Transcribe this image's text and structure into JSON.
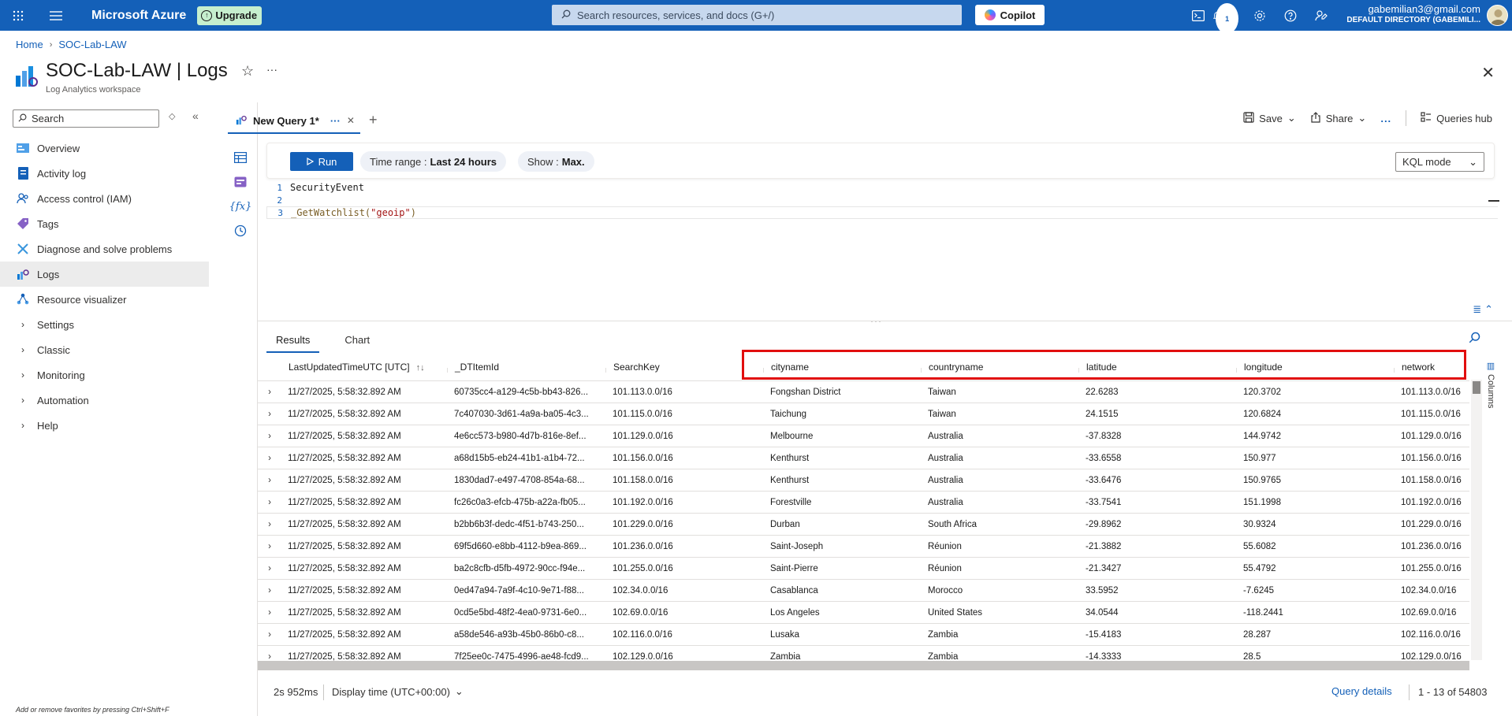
{
  "topbar": {
    "brand": "Microsoft Azure",
    "upgrade_label": "Upgrade",
    "search_placeholder": "Search resources, services, and docs (G+/)",
    "copilot_label": "Copilot",
    "notification_count": "1",
    "user_email": "gabemilian3@gmail.com",
    "user_directory": "DEFAULT DIRECTORY (GABEMILI..."
  },
  "breadcrumb": [
    "Home",
    "SOC-Lab-LAW"
  ],
  "header": {
    "title": "SOC-Lab-LAW | Logs",
    "subtitle": "Log Analytics workspace"
  },
  "sidebar": {
    "search_placeholder": "Search",
    "items": [
      {
        "label": "Overview",
        "icon": "overview-icon"
      },
      {
        "label": "Activity log",
        "icon": "activity-log-icon"
      },
      {
        "label": "Access control (IAM)",
        "icon": "iam-icon"
      },
      {
        "label": "Tags",
        "icon": "tag-icon"
      },
      {
        "label": "Diagnose and solve problems",
        "icon": "wrench-icon"
      },
      {
        "label": "Logs",
        "icon": "logs-icon",
        "active": true
      },
      {
        "label": "Resource visualizer",
        "icon": "visualizer-icon"
      },
      {
        "label": "Settings",
        "expandable": true
      },
      {
        "label": "Classic",
        "expandable": true
      },
      {
        "label": "Monitoring",
        "expandable": true
      },
      {
        "label": "Automation",
        "expandable": true
      },
      {
        "label": "Help",
        "expandable": true
      }
    ],
    "footer_hint": "Add or remove favorites by pressing Ctrl+Shift+F"
  },
  "query_tab": {
    "label": "New Query 1*"
  },
  "toolbar": {
    "save_label": "Save",
    "share_label": "Share",
    "more_label": "...",
    "queries_hub_label": "Queries hub"
  },
  "runbar": {
    "run_label": "Run",
    "time_range_label": "Time range :",
    "time_range_value": "Last 24 hours",
    "show_label": "Show :",
    "show_value": "Max.",
    "mode": "KQL mode"
  },
  "editor": {
    "lines": [
      {
        "num": "1",
        "text": "SecurityEvent"
      },
      {
        "num": "2",
        "text": ""
      },
      {
        "num": "3",
        "fn": "_GetWatchlist(",
        "str": "\"geoip\"",
        "close": ")"
      }
    ]
  },
  "results": {
    "tabs": [
      "Results",
      "Chart"
    ],
    "columns": [
      "LastUpdatedTimeUTC [UTC]",
      "_DTItemId",
      "SearchKey",
      "cityname",
      "countryname",
      "latitude",
      "longitude",
      "network"
    ],
    "rows": [
      [
        "11/27/2025, 5:58:32.892 AM",
        "60735cc4-a129-4c5b-bb43-826...",
        "101.113.0.0/16",
        "Fongshan District",
        "Taiwan",
        "22.6283",
        "120.3702",
        "101.113.0.0/16"
      ],
      [
        "11/27/2025, 5:58:32.892 AM",
        "7c407030-3d61-4a9a-ba05-4c3...",
        "101.115.0.0/16",
        "Taichung",
        "Taiwan",
        "24.1515",
        "120.6824",
        "101.115.0.0/16"
      ],
      [
        "11/27/2025, 5:58:32.892 AM",
        "4e6cc573-b980-4d7b-816e-8ef...",
        "101.129.0.0/16",
        "Melbourne",
        "Australia",
        "-37.8328",
        "144.9742",
        "101.129.0.0/16"
      ],
      [
        "11/27/2025, 5:58:32.892 AM",
        "a68d15b5-eb24-41b1-a1b4-72...",
        "101.156.0.0/16",
        "Kenthurst",
        "Australia",
        "-33.6558",
        "150.977",
        "101.156.0.0/16"
      ],
      [
        "11/27/2025, 5:58:32.892 AM",
        "1830dad7-e497-4708-854a-68...",
        "101.158.0.0/16",
        "Kenthurst",
        "Australia",
        "-33.6476",
        "150.9765",
        "101.158.0.0/16"
      ],
      [
        "11/27/2025, 5:58:32.892 AM",
        "fc26c0a3-efcb-475b-a22a-fb05...",
        "101.192.0.0/16",
        "Forestville",
        "Australia",
        "-33.7541",
        "151.1998",
        "101.192.0.0/16"
      ],
      [
        "11/27/2025, 5:58:32.892 AM",
        "b2bb6b3f-dedc-4f51-b743-250...",
        "101.229.0.0/16",
        "Durban",
        "South Africa",
        "-29.8962",
        "30.9324",
        "101.229.0.0/16"
      ],
      [
        "11/27/2025, 5:58:32.892 AM",
        "69f5d660-e8bb-4112-b9ea-869...",
        "101.236.0.0/16",
        "Saint-Joseph",
        "Réunion",
        "-21.3882",
        "55.6082",
        "101.236.0.0/16"
      ],
      [
        "11/27/2025, 5:58:32.892 AM",
        "ba2c8cfb-d5fb-4972-90cc-f94e...",
        "101.255.0.0/16",
        "Saint-Pierre",
        "Réunion",
        "-21.3427",
        "55.4792",
        "101.255.0.0/16"
      ],
      [
        "11/27/2025, 5:58:32.892 AM",
        "0ed47a94-7a9f-4c10-9e71-f88...",
        "102.34.0.0/16",
        "Casablanca",
        "Morocco",
        "33.5952",
        "-7.6245",
        "102.34.0.0/16"
      ],
      [
        "11/27/2025, 5:58:32.892 AM",
        "0cd5e5bd-48f2-4ea0-9731-6e0...",
        "102.69.0.0/16",
        "Los Angeles",
        "United States",
        "34.0544",
        "-118.2441",
        "102.69.0.0/16"
      ],
      [
        "11/27/2025, 5:58:32.892 AM",
        "a58de546-a93b-45b0-86b0-c8...",
        "102.116.0.0/16",
        "Lusaka",
        "Zambia",
        "-15.4183",
        "28.287",
        "102.116.0.0/16"
      ],
      [
        "11/27/2025, 5:58:32.892 AM",
        "7f25ee0c-7475-4996-ae48-fcd9...",
        "102.129.0.0/16",
        "Zambia",
        "Zambia",
        "-14.3333",
        "28.5",
        "102.129.0.0/16"
      ]
    ],
    "columns_panel_label": "Columns"
  },
  "status": {
    "duration": "2s 952ms",
    "display_time": "Display time (UTC+00:00)",
    "query_details": "Query details",
    "count": "1 - 13 of 54803"
  },
  "colors": {
    "topbar": "#1460b8",
    "accent": "#1460b8",
    "highlight_box": "#e10e0e"
  }
}
